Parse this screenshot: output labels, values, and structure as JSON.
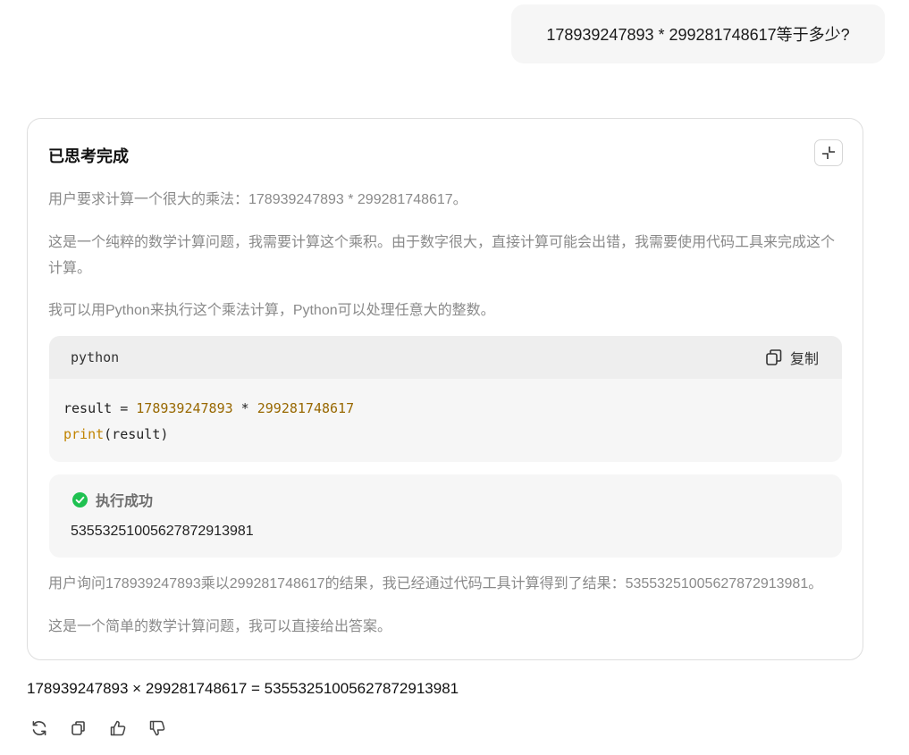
{
  "user_message": "178939247893 * 299281748617等于多少?",
  "thinking": {
    "title": "已思考完成",
    "paragraphs": [
      "用户要求计算一个很大的乘法：178939247893 * 299281748617。",
      "这是一个纯粹的数学计算问题，我需要计算这个乘积。由于数字很大，直接计算可能会出错，我需要使用代码工具来完成这个计算。",
      "我可以用Python来执行这个乘法计算，Python可以处理任意大的整数。",
      "用户询问178939247893乘以299281748617的结果，我已经通过代码工具计算得到了结果：53553251005627872913981。",
      "这是一个简单的数学计算问题，我可以直接给出答案。"
    ],
    "code": {
      "language": "python",
      "copy_label": "复制",
      "line1": {
        "var": "result",
        "op1": " = ",
        "num1": "178939247893",
        "op2": " * ",
        "num2": "299281748617"
      },
      "line2": {
        "fn": "print",
        "args": "(result)"
      }
    },
    "result": {
      "status": "执行成功",
      "value": "53553251005627872913981",
      "status_color": "#1fc151"
    }
  },
  "answer": "178939247893 × 299281748617 = 53553251005627872913981",
  "actions": [
    "refresh-icon",
    "copy-icon",
    "thumbs-up-icon",
    "thumbs-down-icon"
  ]
}
